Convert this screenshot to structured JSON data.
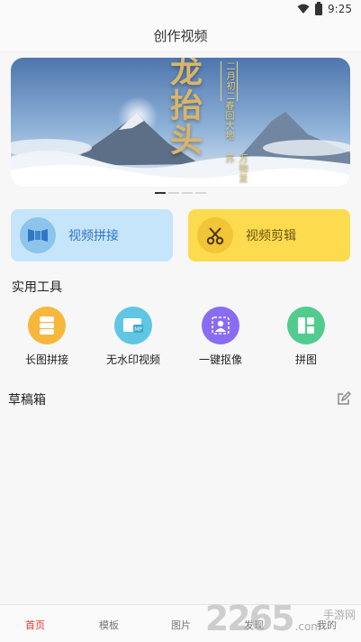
{
  "status_bar": {
    "time": "9:25",
    "wifi_icon": "wifi-icon",
    "battery_icon": "battery-icon"
  },
  "header": {
    "title": "创作视频"
  },
  "banner": {
    "title": "龙抬头",
    "side_texts": [
      "二月初二",
      "春回大地",
      "万物复苏"
    ],
    "active_index": 0,
    "dot_count": 4
  },
  "primary_actions": [
    {
      "label": "视频拼接",
      "icon": "film-stitch-icon",
      "color": "#c6e5fb"
    },
    {
      "label": "视频剪辑",
      "icon": "scissors-icon",
      "color": "#fcdc4e"
    }
  ],
  "tools": {
    "title": "实用工具",
    "items": [
      {
        "label": "长图拼接",
        "icon": "long-image-icon",
        "color": "#f6b73c"
      },
      {
        "label": "无水印视频",
        "icon": "mp-video-icon",
        "color": "#5fc6e4"
      },
      {
        "label": "一键抠像",
        "icon": "portrait-cutout-icon",
        "color": "#8a6cf2"
      },
      {
        "label": "拼图",
        "icon": "collage-icon",
        "color": "#52cc8e"
      }
    ]
  },
  "drafts": {
    "title": "草稿箱",
    "edit_icon": "edit-icon"
  },
  "tab_bar": {
    "tabs": [
      {
        "label": "首页",
        "active": true
      },
      {
        "label": "模板",
        "active": false
      },
      {
        "label": "图片",
        "active": false
      },
      {
        "label": "发现",
        "active": false
      },
      {
        "label": "我的",
        "active": false
      }
    ]
  },
  "watermark": {
    "number": "2265",
    "suffix": ".com",
    "site": "手游网"
  }
}
